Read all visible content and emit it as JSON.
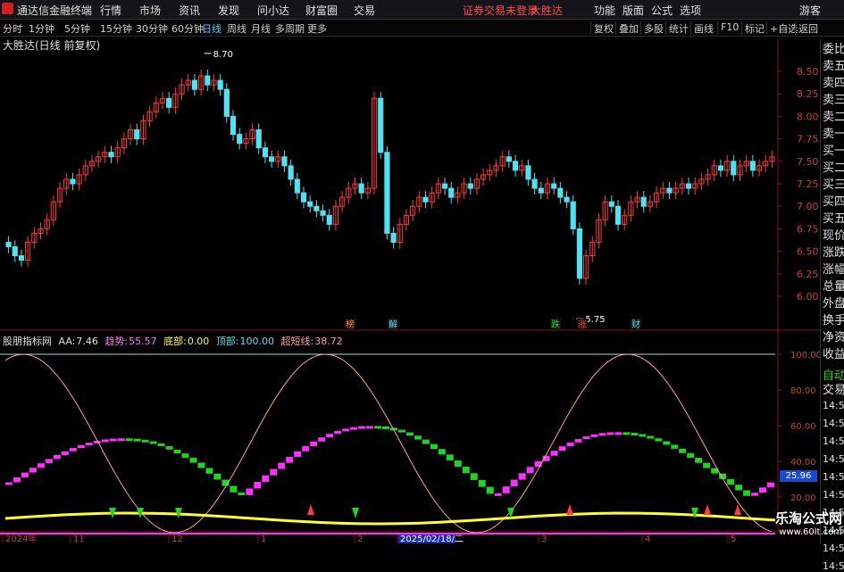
{
  "menu": {
    "app_title": "通达信金融终端",
    "items": [
      "行情",
      "市场",
      "资讯",
      "发现",
      "问小达",
      "财富圈",
      "交易"
    ],
    "warning": "证券交易未登录",
    "stock": "大胜达",
    "right_items": [
      "功能",
      "版面",
      "公式",
      "选项"
    ],
    "guest": "游客"
  },
  "periods": {
    "items": [
      "分时",
      "1分钟",
      "5分钟",
      "15分钟",
      "30分钟",
      "60分钟",
      "日线",
      "周线",
      "月线",
      "多周期",
      "更多"
    ],
    "active": "日线",
    "tools": [
      "复权",
      "叠加",
      "多股",
      "统计",
      "画线",
      "F10",
      "标记",
      "+自选",
      "返回"
    ]
  },
  "chart_title": "大胜达(日线 前复权)",
  "side_labels": [
    "委比",
    "卖五",
    "卖四",
    "卖三",
    "卖二",
    "卖一",
    "买一",
    "买二",
    "买三",
    "买四",
    "买五",
    "现价",
    "涨跌",
    "涨幅",
    "总量",
    "外盘",
    "换手",
    "净资",
    "收益",
    "自动",
    "交易",
    "14:5",
    "14:5",
    "14:5",
    "14:5",
    "14:5",
    "14:5",
    "14:5",
    "14:5",
    "14:5",
    "14:5"
  ],
  "indicator": {
    "name": "股朋指标网",
    "aa_label": "AA:",
    "aa": "7.46",
    "trend_label": "趋势:",
    "trend": "55.57",
    "bottom_label": "底部:",
    "bottom": "0.00",
    "top_label": "顶部:",
    "top": "100.00",
    "super_label": "超短线:",
    "super": "38.72",
    "current_badge": "25.96"
  },
  "watermark": {
    "cn": "乐淘公式网",
    "url": "www.60lt.com"
  },
  "colors": {
    "up": "#ff3b3b",
    "down": "#54e0f0",
    "trend": "#f080f0",
    "pink": "#ffa0a0",
    "yellow": "#ffff30",
    "green": "#22d422",
    "magenta": "#ff30ff"
  },
  "chart_data": [
    {
      "type": "candlestick",
      "title": "大胜达(日线 前复权)",
      "ylim": [
        5.55,
        8.92
      ],
      "yticks": [
        "8.50",
        "8.25",
        "8.00",
        "7.75",
        "7.50",
        "7.25",
        "7.00",
        "6.75",
        "6.50",
        "6.25",
        "6.00"
      ],
      "x_labels": [
        "2024年",
        "11",
        "12",
        "1",
        "2",
        "2025/02/18/二",
        "3",
        "4",
        "5"
      ],
      "annotations": {
        "high": "8.70",
        "low": "5.75"
      },
      "event_marks": [
        "榜",
        "解",
        "跌",
        "涨",
        "财"
      ]
    },
    {
      "type": "line",
      "title": "股朋指标网",
      "ylim": [
        0,
        112
      ],
      "yticks": [
        "100.00",
        "80.00",
        "60.00",
        "40.00",
        "20.00"
      ],
      "series": [
        {
          "name": "趋势"
        },
        {
          "name": "超短线"
        },
        {
          "name": "底部"
        },
        {
          "name": "顶部"
        }
      ]
    }
  ]
}
